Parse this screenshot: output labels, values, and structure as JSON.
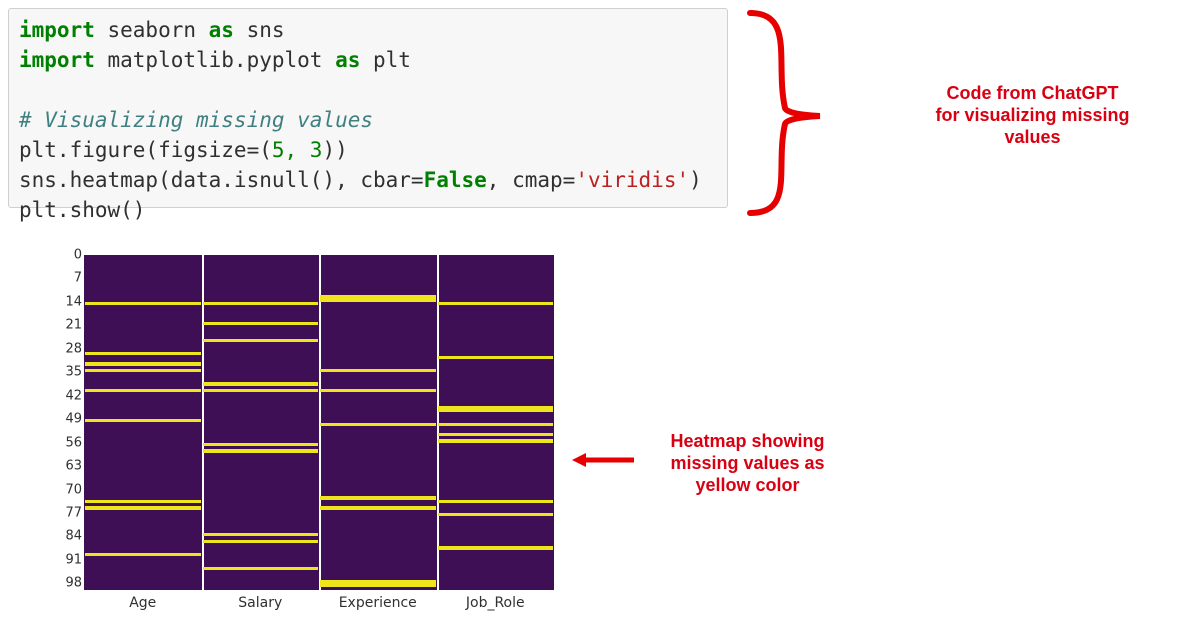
{
  "code": {
    "l1_kw": "import",
    "l1_rest": " seaborn ",
    "l1_as": "as",
    "l1_alias": " sns",
    "l2_kw": "import",
    "l2_rest": " matplotlib.pyplot ",
    "l2_as": "as",
    "l2_alias": " plt",
    "comment": "# Visualizing missing values",
    "l4": "plt.figure(figsize=(",
    "l4_num": "5, 3",
    "l4_end": "))",
    "l5a": "sns.heatmap(data.isnull(), cbar=",
    "l5_false": "False",
    "l5b": ", cmap=",
    "l5_str": "'viridis'",
    "l5c": ")",
    "l6": "plt.show()"
  },
  "annotations": {
    "top_line1": "Code from ChatGPT",
    "top_line2": "for visualizing missing",
    "top_line3": "values",
    "side_line1": "Heatmap showing",
    "side_line2": "missing values as",
    "side_line3": "yellow color"
  },
  "chart_data": {
    "type": "heatmap",
    "title": "",
    "xlabel": "",
    "ylabel": "",
    "columns": [
      "Age",
      "Salary",
      "Experience",
      "Job_Role"
    ],
    "y_ticks": [
      0,
      7,
      14,
      21,
      28,
      35,
      42,
      49,
      56,
      63,
      70,
      77,
      84,
      91,
      98
    ],
    "n_rows": 100,
    "missing_rows": {
      "Age": [
        14,
        29,
        32,
        34,
        40,
        49,
        73,
        75,
        89
      ],
      "Salary": [
        14,
        20,
        25,
        38,
        40,
        56,
        58,
        83,
        85,
        93
      ],
      "Experience": [
        12,
        13,
        34,
        40,
        50,
        72,
        75,
        97,
        98
      ],
      "Job_Role": [
        14,
        30,
        45,
        46,
        50,
        53,
        55,
        73,
        77,
        87
      ]
    },
    "cmap": "viridis",
    "cbar": false
  }
}
